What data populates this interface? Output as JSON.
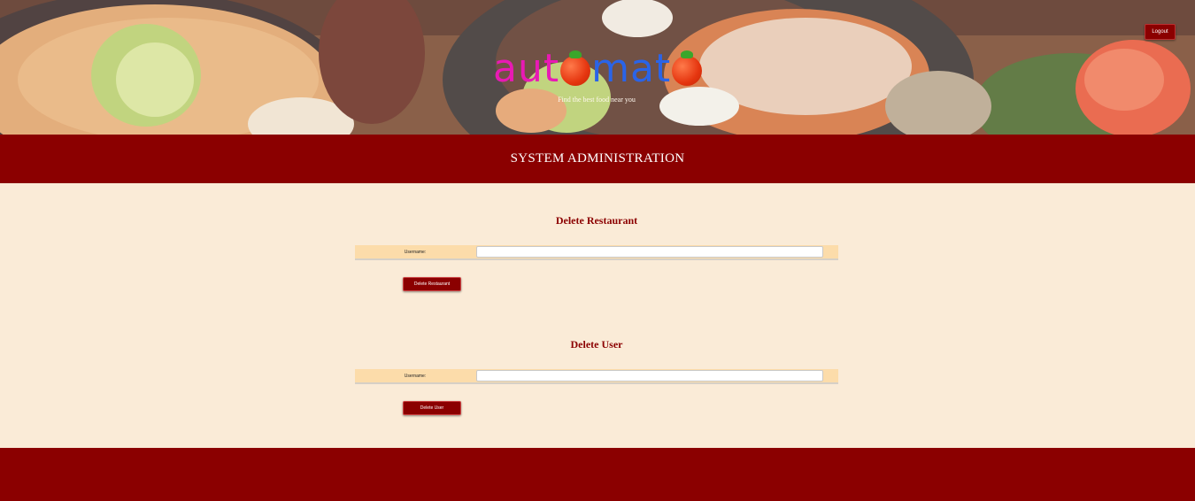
{
  "header": {
    "logo_part1": "aut",
    "logo_part2": "mat",
    "tagline": "Find the best food near you",
    "logout_label": "Logout"
  },
  "page_title": "SYSTEM ADMINISTRATION",
  "delete_restaurant": {
    "title": "Delete Restaurant",
    "username_label": "Username:",
    "username_value": "",
    "button_label": "Delete Restaurant"
  },
  "delete_user": {
    "title": "Delete User",
    "username_label": "Username:",
    "username_value": "",
    "button_label": "Delete User"
  },
  "colors": {
    "brand_red": "#8b0000",
    "page_bg": "#faebd7",
    "row_bg": "#fcdcaa",
    "logo_pink": "#e81ab4",
    "logo_blue": "#2a64e8"
  }
}
